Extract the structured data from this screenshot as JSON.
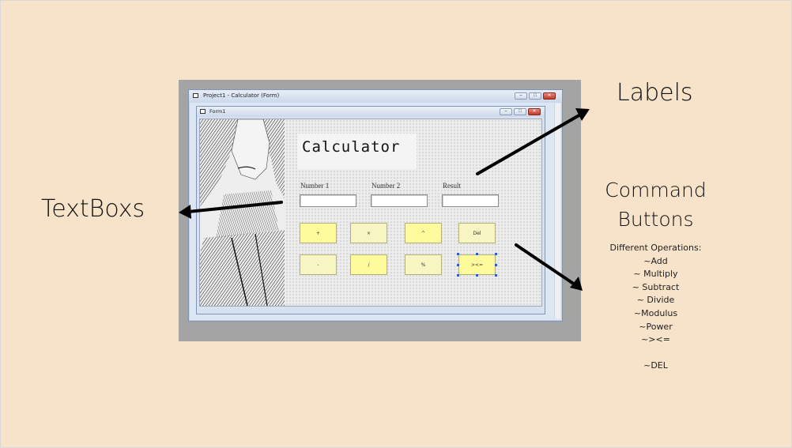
{
  "labels": {
    "labels_title": "Labels",
    "textboxes_title": "TextBoxs",
    "command_line1": "Command",
    "command_line2": "Buttons"
  },
  "operations": [
    "Different Operations:",
    "~Add",
    "~ Multiply",
    "~ Subtract",
    "~ Divide",
    "~Modulus",
    "~Power",
    "~><=",
    "",
    "~DEL"
  ],
  "project_window": {
    "title": "Project1 - Calculator (Form)",
    "controls": [
      "–",
      "□",
      "✕"
    ]
  },
  "form_window": {
    "title": "Form1",
    "controls": [
      "–",
      "□",
      "✕"
    ]
  },
  "form": {
    "heading": "Calculator",
    "field_labels": [
      "Number 1",
      "Number 2",
      "Result"
    ],
    "buttons_row1": [
      "+",
      "×",
      "^",
      "Del"
    ],
    "buttons_row2": [
      "-",
      "/",
      "%",
      "><="
    ]
  },
  "colors": {
    "background": "#f6e3c9",
    "button_yellow": "#fdfb9c",
    "button_pale": "#f7f5c2",
    "selection_handle": "#2a5bd7"
  }
}
